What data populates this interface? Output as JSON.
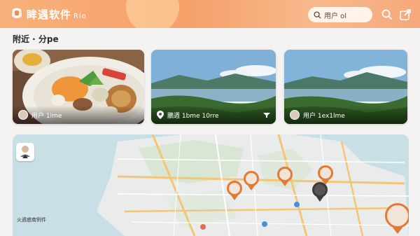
{
  "header": {
    "title": "眸遇软件",
    "title_suffix": "Rio",
    "search": {
      "value": "用户 ol"
    },
    "icons": [
      "app-logo-icon",
      "search-icon",
      "share-icon"
    ],
    "accent": "#f6a06a"
  },
  "nearby": {
    "title": "附近 · 分pe",
    "cards": [
      {
        "type": "food",
        "caption": "用户 1lme"
      },
      {
        "type": "landscape",
        "caption": "鵬週 1bme 10rre"
      },
      {
        "type": "landscape",
        "caption": "用户 1ex1lme"
      }
    ]
  },
  "map": {
    "label": "火週惑南例件",
    "water_color": "#c9dfe6",
    "land_color": "#e9ecea",
    "road_color": "#f4c577",
    "pin_color": "#e07a35"
  }
}
